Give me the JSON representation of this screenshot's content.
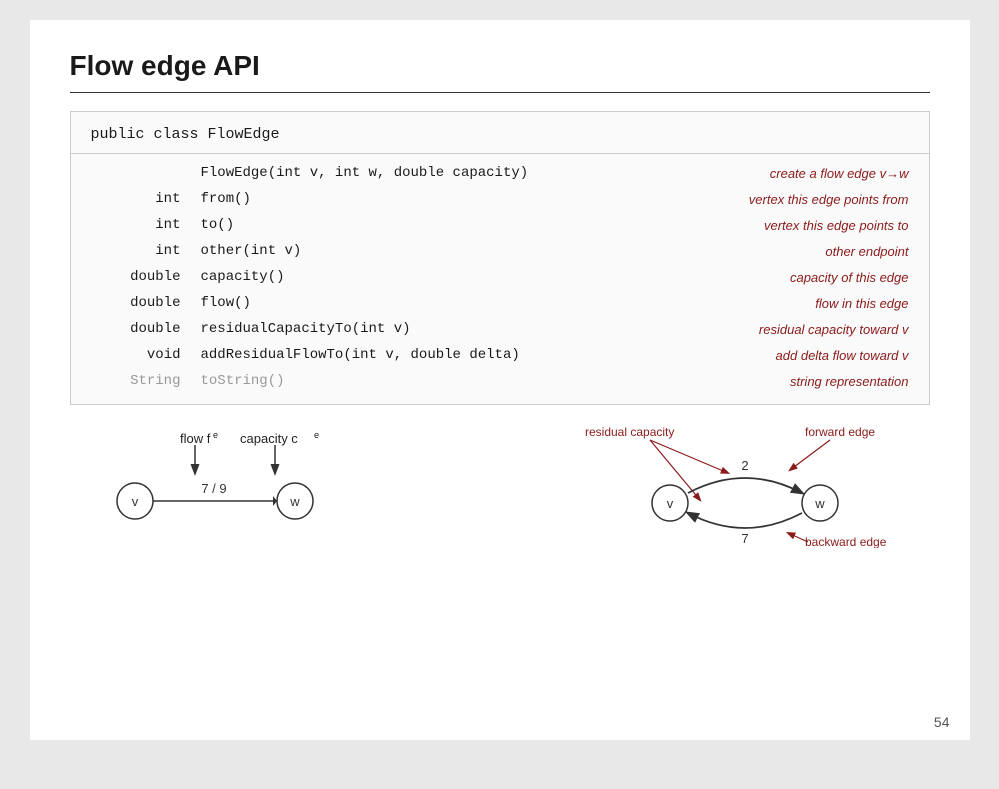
{
  "slide": {
    "title": "Flow edge API",
    "page_number": "54",
    "api_class": "public class FlowEdge",
    "api_rows": [
      {
        "type": "",
        "method": "FlowEdge(int v, int w, double capacity)",
        "desc": "create a flow edge v→w",
        "type_dark": false
      },
      {
        "type": "int",
        "method": "from()",
        "desc": "vertex this edge points from",
        "type_dark": true
      },
      {
        "type": "int",
        "method": "to()",
        "desc": "vertex this edge points to",
        "type_dark": true
      },
      {
        "type": "int",
        "method": "other(int v)",
        "desc": "other endpoint",
        "type_dark": true
      },
      {
        "type": "double",
        "method": "capacity()",
        "desc": "capacity of this edge",
        "type_dark": true
      },
      {
        "type": "double",
        "method": "flow()",
        "desc": "flow in this edge",
        "type_dark": true
      },
      {
        "type": "double",
        "method": "residualCapacityTo(int v)",
        "desc": "residual capacity toward v",
        "type_dark": true
      },
      {
        "type": "void",
        "method": "addResidualFlowTo(int v, double delta)",
        "desc": "add delta flow toward v",
        "type_dark": true
      },
      {
        "type": "String",
        "method": "toString()",
        "desc": "string representation",
        "type_dark": false
      }
    ],
    "diagram_left": {
      "label_flow": "flow f",
      "label_flow_sub": "e",
      "label_capacity": "capacity c",
      "label_capacity_sub": "e",
      "label_v": "v",
      "label_w": "w",
      "label_ratio": "7 / 9"
    },
    "diagram_right": {
      "label_residual": "residual capacity",
      "label_forward": "forward edge",
      "label_backward": "backward edge",
      "label_v": "v",
      "label_w": "w",
      "label_2": "2",
      "label_7": "7"
    }
  }
}
